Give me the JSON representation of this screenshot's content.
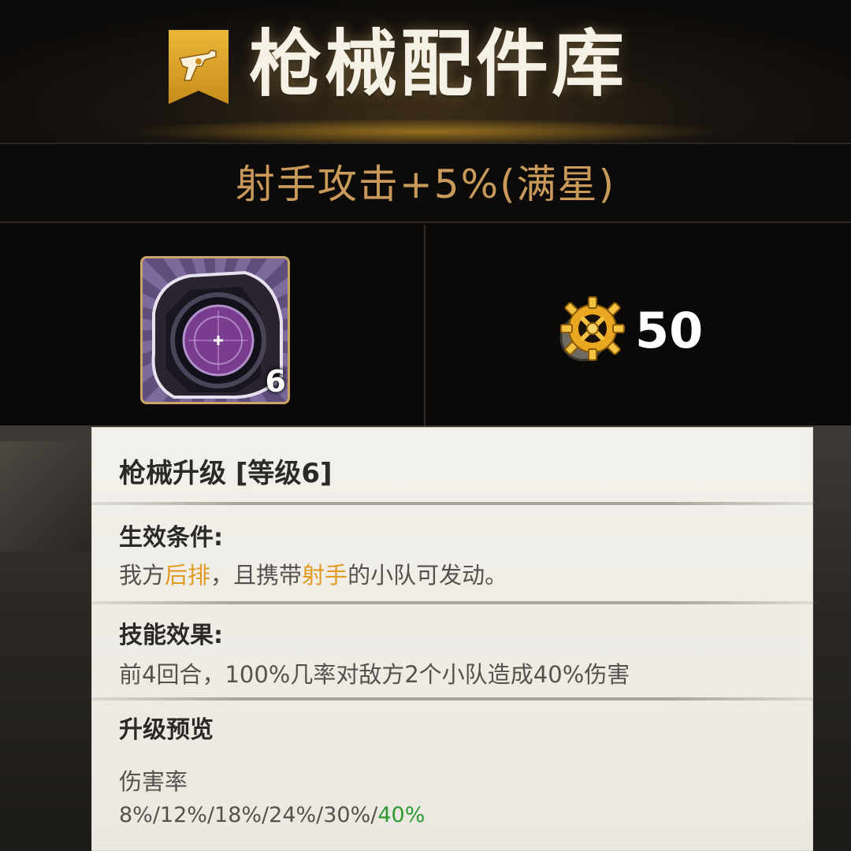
{
  "header": {
    "title": "枪械配件库",
    "badge_icon": "revolver-icon",
    "accent_color": "#e4ab36"
  },
  "accessory": {
    "name": "射手攻击+5%(满星)",
    "icon": "scope-icon",
    "level": "6",
    "cost_icon": "gear-icon",
    "cost_value": "50"
  },
  "tooltip": {
    "title": "枪械升级 [等级6]",
    "condition": {
      "heading": "生效条件:",
      "parts": [
        "我方",
        "后排",
        "，且携带",
        "射手",
        "的小队可发动。"
      ]
    },
    "effect": {
      "heading": "技能效果:",
      "text": "前4回合，100%几率对敌方2个小队造成40%伤害"
    },
    "preview": {
      "heading": "升级预览",
      "stat_label": "伤害率",
      "values_prefix": "8%/12%/18%/24%/30%/",
      "values_current": "40%"
    },
    "highlight_color": "#e19a22",
    "current_value_color": "#2f9a34"
  }
}
